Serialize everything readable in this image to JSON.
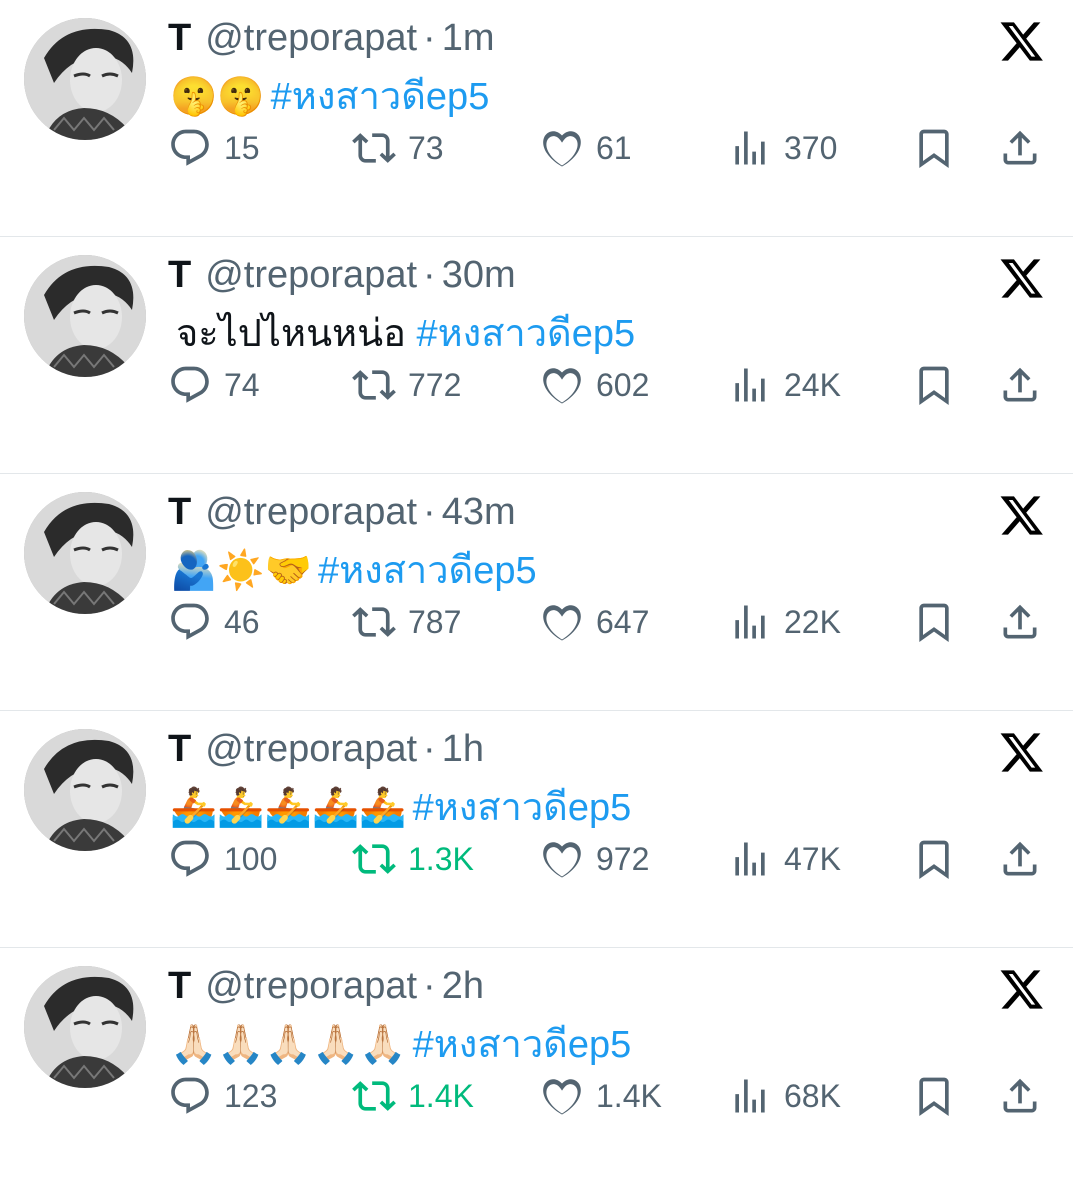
{
  "tweets": [
    {
      "name": "T",
      "handle": "@treporapat",
      "separator": "·",
      "time": "1m",
      "emojis": "🤫🤫",
      "text": "",
      "hashtag": "#หงสาวดีep5",
      "replies": "15",
      "retweets": "73",
      "likes": "61",
      "views": "370",
      "retweeted": false
    },
    {
      "name": "T",
      "handle": "@treporapat",
      "separator": "·",
      "time": "30m",
      "emojis": "",
      "text": "จะไปไหนหน่อ ",
      "hashtag": "#หงสาวดีep5",
      "replies": "74",
      "retweets": "772",
      "likes": "602",
      "views": "24K",
      "retweeted": false
    },
    {
      "name": "T",
      "handle": "@treporapat",
      "separator": "·",
      "time": "43m",
      "emojis": "🫂☀️🤝",
      "text": "",
      "hashtag": "#หงสาวดีep5",
      "replies": "46",
      "retweets": "787",
      "likes": "647",
      "views": "22K",
      "retweeted": false
    },
    {
      "name": "T",
      "handle": "@treporapat",
      "separator": "·",
      "time": "1h",
      "emojis": "🚣🚣🚣🚣🚣",
      "text": "",
      "hashtag": "#หงสาวดีep5",
      "replies": "100",
      "retweets": "1.3K",
      "likes": "972",
      "views": "47K",
      "retweeted": true
    },
    {
      "name": "T",
      "handle": "@treporapat",
      "separator": "·",
      "time": "2h",
      "emojis": "🙏🏻🙏🏻🙏🏻🙏🏻🙏🏻",
      "text": "",
      "hashtag": "#หงสาวดีep5",
      "replies": "123",
      "retweets": "1.4K",
      "likes": "1.4K",
      "views": "68K",
      "retweeted": true
    }
  ],
  "icons": {
    "reply": "reply-icon",
    "retweet": "retweet-icon",
    "like": "heart-icon",
    "views": "views-icon",
    "bookmark": "bookmark-icon",
    "share": "share-icon",
    "source": "x-logo-icon"
  },
  "colors": {
    "accent": "#1d9bf0",
    "muted": "#536471",
    "retweet_active": "#00ba7c"
  }
}
